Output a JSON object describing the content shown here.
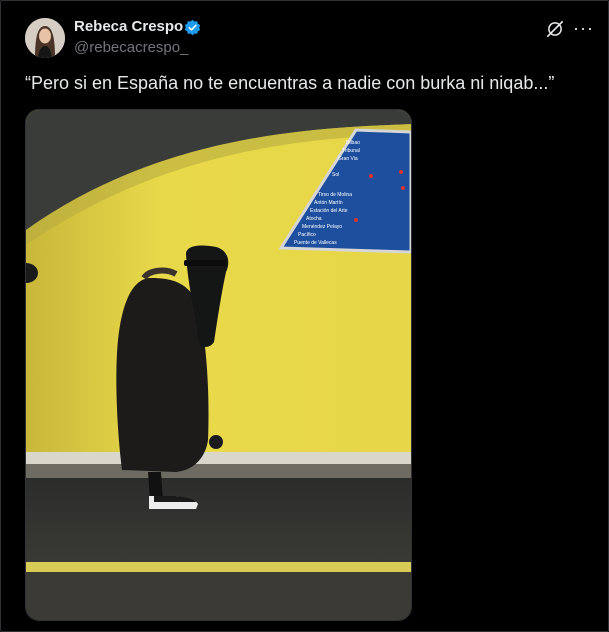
{
  "post": {
    "author_name": "Rebeca Crespo",
    "author_handle": "@rebecacrespo_",
    "text": "“Pero si en España no te encuentras a nadie con burka ni niqab...”",
    "more_icon": "more-icon",
    "verified_color": "#1d9bf0"
  },
  "photo": {
    "sign_lines": [
      "Bilbao",
      "Tribunal",
      "Gran Via",
      "Sol",
      "Tirso de Molina",
      "Antón Martín",
      "Estación del Arte",
      "Atocha",
      "Menéndez Pelayo",
      "Pacífico",
      "Puente de Vallecas"
    ]
  }
}
